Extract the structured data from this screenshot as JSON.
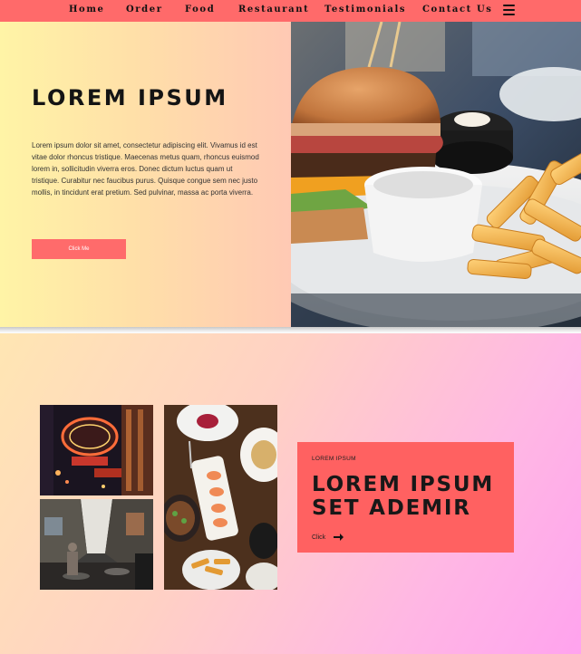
{
  "nav": {
    "items": [
      "Home",
      "Order",
      "Food",
      "Restaurant",
      "Testimonials",
      "Contact Us"
    ],
    "menu_icon": "hamburger-menu-icon"
  },
  "hero": {
    "title": "LOREM IPSUM",
    "text": "Lorem ipsum dolor sit amet, consectetur adipiscing elit. Vivamus id est vitae dolor rhoncus tristique. Maecenas metus quam, rhoncus euismod lorem in, sollicitudin viverra eros. Donec dictum luctus quam ut tristique. Curabitur nec faucibus purus. Quisque congue sem nec justo mollis, in tincidunt erat pretium. Sed pulvinar, massa ac porta viverra.",
    "button_label": "Click Me"
  },
  "feature": {
    "eyebrow": "LOREM IPSUM",
    "title_line1": "LOREM IPSUM",
    "title_line2": "SET ADEMIR",
    "link_label": "Click",
    "link_icon": "arrow-right-icon"
  },
  "colors": {
    "nav_bg": "#ff6a6a",
    "accent": "#ff6161",
    "button": "#ff6b6b"
  }
}
